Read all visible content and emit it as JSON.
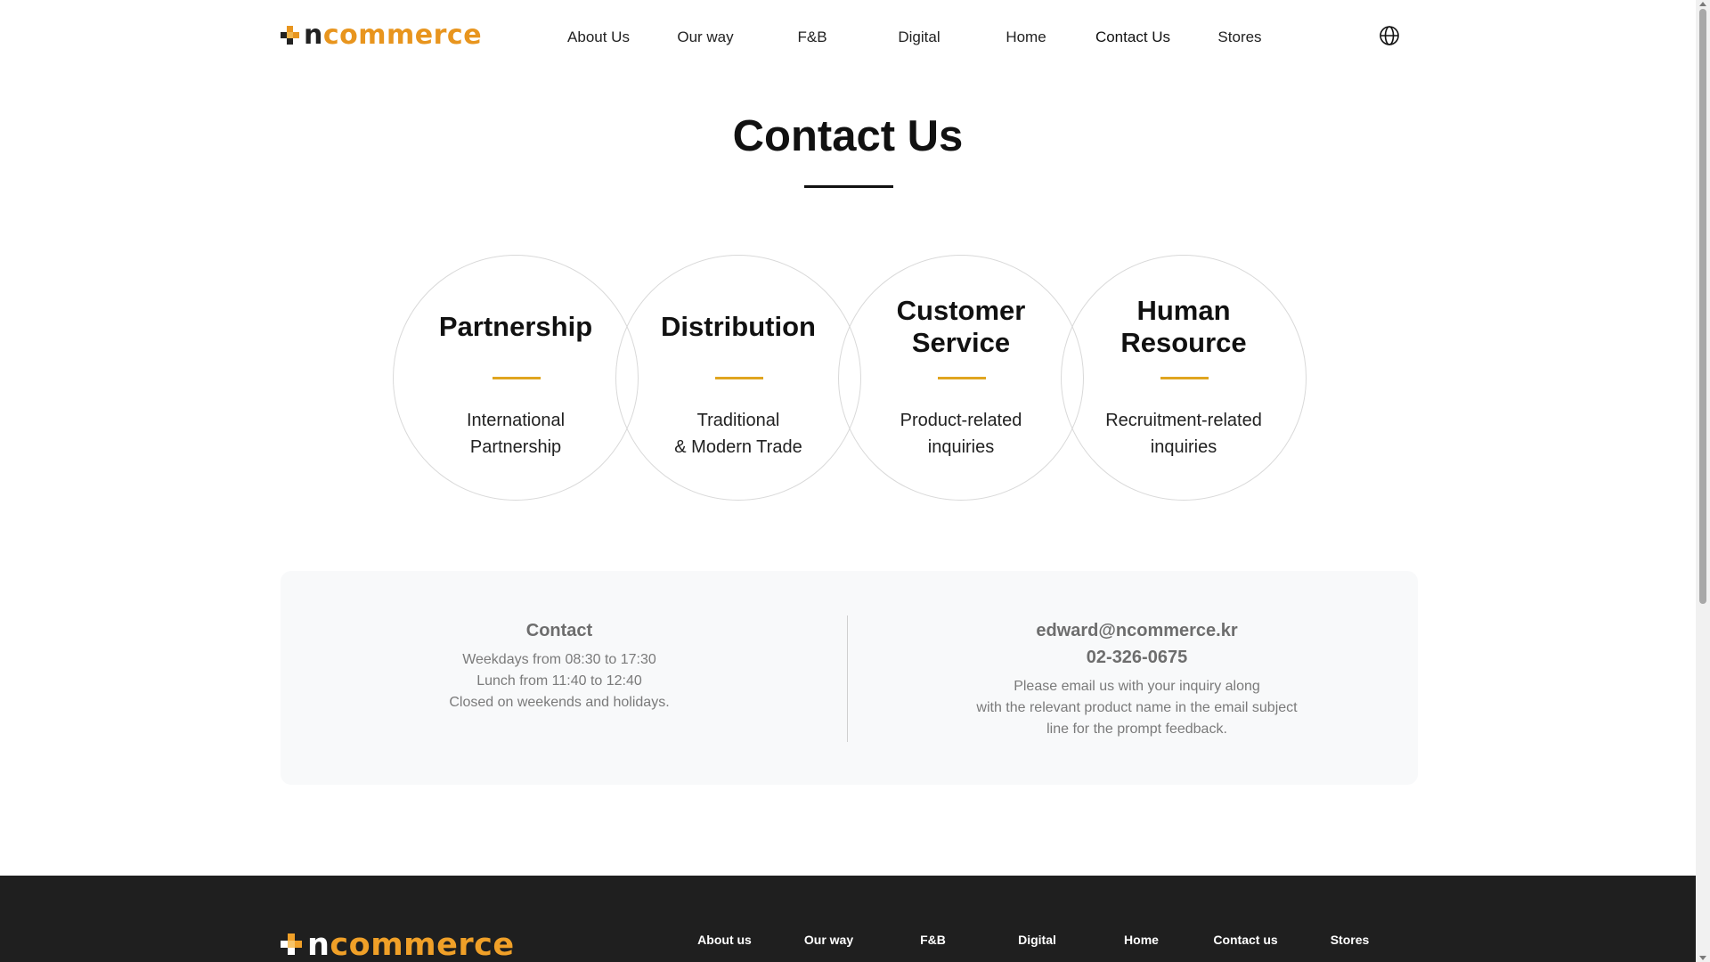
{
  "header": {
    "logo_prefix": "n",
    "logo_suffix": "commerce",
    "nav": [
      "About Us",
      "Our way",
      "F&B",
      "Digital",
      "Home",
      "Contact Us",
      "Stores"
    ],
    "language_icon": "globe-icon"
  },
  "main": {
    "title": "Contact Us",
    "categories": [
      {
        "title": "Partnership",
        "description": "International\nPartnership"
      },
      {
        "title": "Distribution",
        "description": "Traditional\n& Modern Trade"
      },
      {
        "title": "Customer\nService",
        "description": "Product-related\ninquiries"
      },
      {
        "title": "Human\nResource",
        "description": "Recruitment-related\ninquiries"
      }
    ],
    "contact": {
      "left": {
        "heading": "Contact",
        "lines": [
          "Weekdays from 08:30 to 17:30",
          "Lunch from 11:40 to 12:40",
          "Closed on weekends and holidays."
        ]
      },
      "right": {
        "email": "edward@ncommerce.kr",
        "phone": "02-326-0675",
        "lines": [
          "Please email us with your inquiry along",
          "with the relevant product name in the email subject",
          "line for the prompt feedback."
        ]
      }
    }
  },
  "footer": {
    "logo_prefix": "n",
    "logo_suffix": "commerce",
    "nav": [
      "About us",
      "Our way",
      "F&B",
      "Digital",
      "Home",
      "Contact us",
      "Stores"
    ]
  },
  "colors": {
    "brand_orange": "#e8951e",
    "accent_gold": "#e0a520",
    "footer_bg": "#1f1f1f",
    "panel_bg": "#f8f9fa"
  }
}
